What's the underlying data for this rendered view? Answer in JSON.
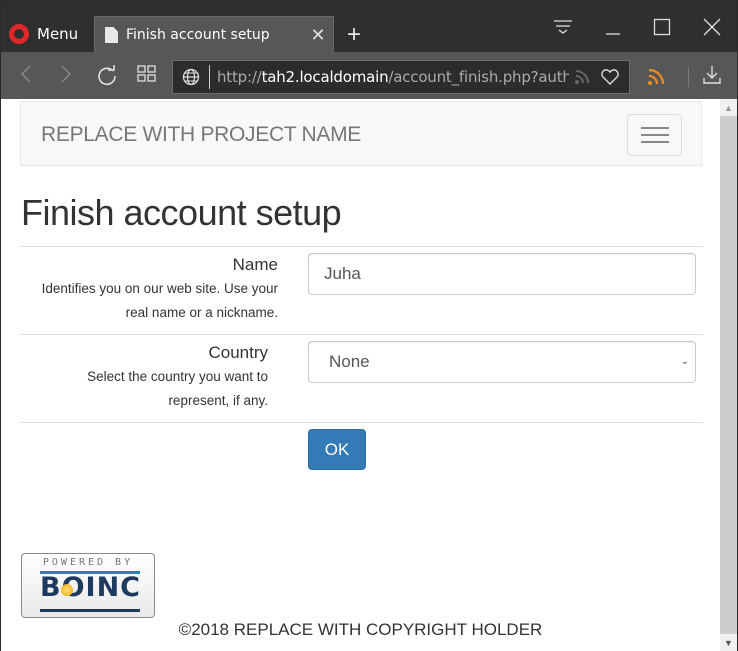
{
  "browser": {
    "menu_label": "Menu",
    "tab_title": "Finish account setup",
    "new_tab_symbol": "+",
    "url_prefix": "http://",
    "url_host": "tah2.localdomain",
    "url_path": "/account_finish.php?auth",
    "icons": [
      "opera-logo-icon",
      "document-icon",
      "close-icon",
      "plus-icon",
      "tab-menu-icon",
      "minimize-icon",
      "maximize-icon",
      "window-close-icon",
      "back-icon",
      "forward-icon",
      "reload-icon",
      "speed-dial-icon",
      "globe-icon",
      "rss-icon",
      "heart-icon",
      "rss-feed-icon",
      "download-icon"
    ],
    "accent_colors": {
      "opera_red": "#e0282b",
      "rss_orange": "#f08c1e"
    }
  },
  "navbar": {
    "brand": "REPLACE WITH PROJECT NAME"
  },
  "page": {
    "title": "Finish account setup",
    "form": {
      "name": {
        "label": "Name",
        "help": "Identifies you on our web site. Use your real name or a nickname.",
        "value": "Juha"
      },
      "country": {
        "label": "Country",
        "help": "Select the country you want to represent, if any.",
        "selected": "None"
      },
      "submit_label": "OK",
      "submit_color": "#337ab7"
    }
  },
  "footer": {
    "badge_top": "POWERED BY",
    "badge_logo": "BOINC",
    "copyright": "©2018 REPLACE WITH COPYRIGHT HOLDER"
  }
}
